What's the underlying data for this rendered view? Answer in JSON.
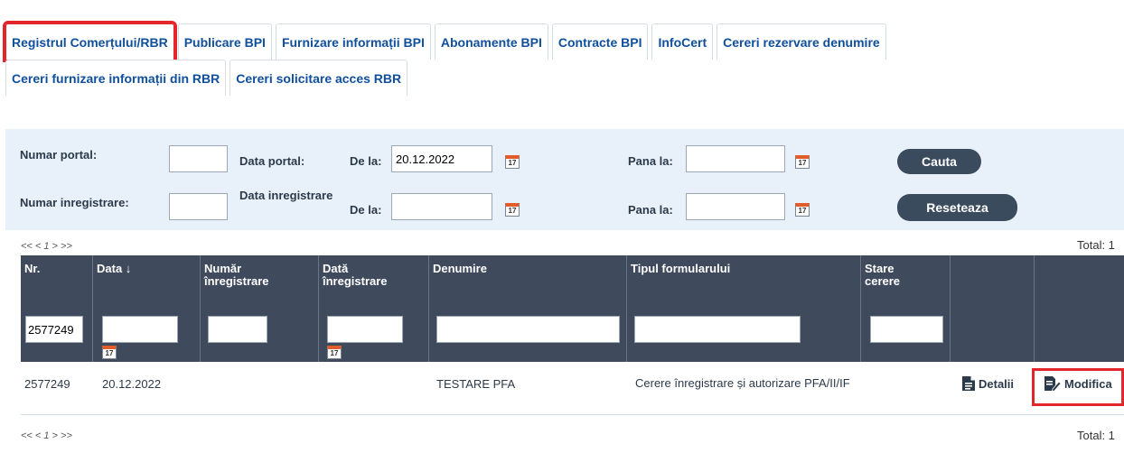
{
  "tabs_row1": [
    {
      "label": "Registrul Comerțului/RBR",
      "active": true
    },
    {
      "label": "Publicare BPI"
    },
    {
      "label": "Furnizare informații BPI"
    },
    {
      "label": "Abonamente BPI"
    },
    {
      "label": "Contracte BPI"
    },
    {
      "label": "InfoCert"
    },
    {
      "label": "Cereri rezervare denumire"
    }
  ],
  "tabs_row2": [
    {
      "label": "Cereri furnizare informații din RBR"
    },
    {
      "label": "Cereri solicitare acces RBR"
    }
  ],
  "filters": {
    "numar_portal_label": "Numar portal:",
    "data_portal_label": "Data portal:",
    "de_la_label": "De la:",
    "de_la_value": "20.12.2022",
    "pana_la_label": "Pana la:",
    "numar_inregistrare_label": "Numar inregistrare:",
    "data_inregistrare_label": "Data inregistrare",
    "de_la2_label": "De la:",
    "pana_la2_label": "Pana la:",
    "search_button": "Cauta",
    "reset_button": "Reseteaza",
    "calendar_glyph": "17"
  },
  "pager": {
    "text": "<< < 1 > >>",
    "total": "Total: 1"
  },
  "table": {
    "headers": {
      "nr": "Nr.",
      "data": "Data ↓",
      "numar_inregistrare": "Număr înregistrare",
      "data_inregistrare": "Dată înregistrare",
      "denumire": "Denumire",
      "tipul_formularului": "Tipul formularului",
      "stare_cerere": "Stare cerere"
    },
    "filter_nr_value": "2577249",
    "rows": [
      {
        "nr": "2577249",
        "data": "20.12.2022",
        "numar_inregistrare": "",
        "data_inregistrare": "",
        "denumire": "TESTARE PFA",
        "tipul_formularului": "Cerere înregistrare și autorizare PFA/II/IF",
        "stare_cerere": "",
        "details_label": "Detalii",
        "modify_label": "Modifica"
      }
    ]
  },
  "colors": {
    "accent": "#0f4f9c",
    "header_bg": "#3f4a5c",
    "filter_bg": "#e8f1fa",
    "highlight": "#e3262b"
  }
}
